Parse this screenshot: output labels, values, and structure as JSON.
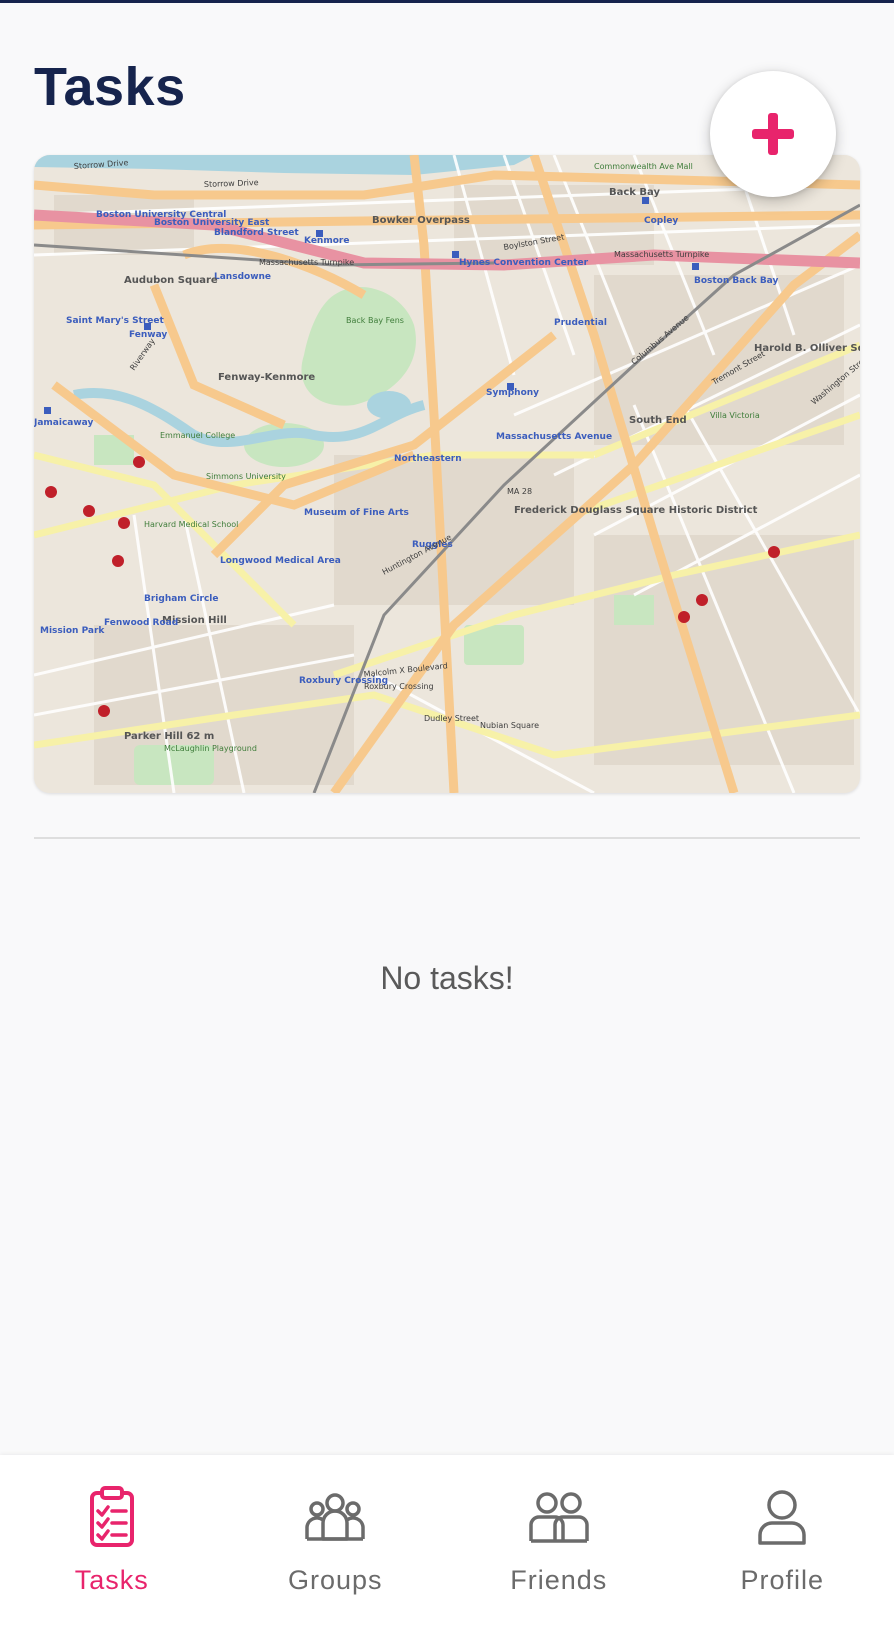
{
  "header": {
    "title": "Tasks"
  },
  "add_button": {
    "icon": "plus-icon",
    "color": "#e8246c"
  },
  "map": {
    "labels": [
      "Storrow Drive",
      "Storrow Drive",
      "Back Bay",
      "Commonwealth Ave Mall",
      "Copley",
      "Boston University Central",
      "Boston University East",
      "Blandford Street",
      "Kenmore",
      "Bowker Overpass",
      "Massachusetts Turnpike",
      "Boylston Street",
      "Hynes Convention Center",
      "Lansdowne",
      "Audubon Square",
      "Saint Mary's Street",
      "Fenway",
      "Back Bay Fens",
      "Prudential",
      "Massachusetts Turnpike",
      "Boston Back Bay",
      "Harold B. Olliver Square",
      "Fenway-Kenmore",
      "Symphony",
      "South End",
      "Emmanuel College",
      "Massachusetts Avenue",
      "Northeastern",
      "MA 28",
      "Frederick Douglass Square Historic District",
      "Simmons University",
      "Museum of Fine Arts",
      "Harvard Medical School",
      "Ruggles",
      "Longwood Medical Area",
      "Brigham Circle",
      "Mission Hill",
      "Fenwood Road",
      "Mission Park",
      "Roxbury Crossing",
      "Roxbury Crossing",
      "Malcolm X Boulevard",
      "Nubian Square",
      "Dudley Street",
      "Parker Hill 62 m",
      "McLaughlin Playground",
      "Villa Victoria",
      "Riverway",
      "Jamaicaway",
      "Tremont Street",
      "Columbus Avenue",
      "Huntington Avenue",
      "Washington Street"
    ]
  },
  "empty_state": {
    "message": "No tasks!"
  },
  "bottom_nav": {
    "active_color": "#e8246c",
    "inactive_color": "#6b6b6b",
    "items": [
      {
        "label": "Tasks",
        "icon": "clipboard-checklist-icon",
        "active": true
      },
      {
        "label": "Groups",
        "icon": "group-icon",
        "active": false
      },
      {
        "label": "Friends",
        "icon": "friends-icon",
        "active": false
      },
      {
        "label": "Profile",
        "icon": "person-icon",
        "active": false
      }
    ]
  }
}
